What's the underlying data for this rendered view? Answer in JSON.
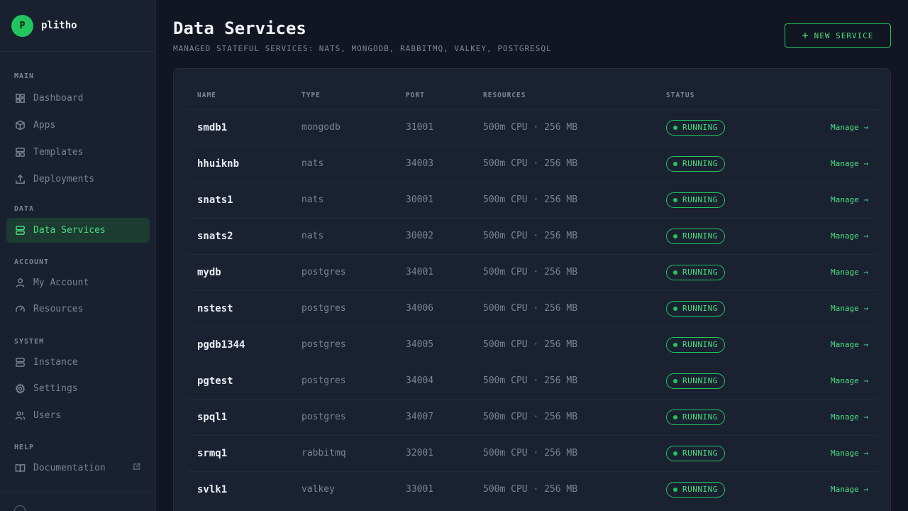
{
  "brand": {
    "logo_letter": "P",
    "name": "plitho"
  },
  "sidebar": {
    "sections": [
      {
        "heading": "MAIN",
        "items": [
          {
            "label": "Dashboard",
            "icon": "grid-icon"
          },
          {
            "label": "Apps",
            "icon": "cube-icon"
          },
          {
            "label": "Templates",
            "icon": "layout-icon"
          },
          {
            "label": "Deployments",
            "icon": "upload-icon"
          }
        ]
      },
      {
        "heading": "DATA",
        "items": [
          {
            "label": "Data Services",
            "icon": "server-icon",
            "active": true
          }
        ]
      },
      {
        "heading": "ACCOUNT",
        "items": [
          {
            "label": "My Account",
            "icon": "user-icon"
          },
          {
            "label": "Resources",
            "icon": "gauge-icon"
          }
        ]
      },
      {
        "heading": "SYSTEM",
        "items": [
          {
            "label": "Instance",
            "icon": "server-icon"
          },
          {
            "label": "Settings",
            "icon": "gear-icon"
          },
          {
            "label": "Users",
            "icon": "users-icon"
          }
        ]
      },
      {
        "heading": "HELP",
        "items": [
          {
            "label": "Documentation",
            "icon": "book-icon",
            "external": true
          }
        ]
      }
    ]
  },
  "header": {
    "title": "Data Services",
    "subtitle": "MANAGED STATEFUL SERVICES: NATS, MONGODB, RABBITMQ, VALKEY, POSTGRESQL",
    "new_button_label": "NEW SERVICE"
  },
  "table": {
    "columns": [
      "NAME",
      "TYPE",
      "PORT",
      "RESOURCES",
      "STATUS"
    ],
    "action_label": "Manage →",
    "rows": [
      {
        "name": "smdb1",
        "type": "mongodb",
        "port": "31001",
        "resources": "500m CPU · 256 MB",
        "status": "RUNNING"
      },
      {
        "name": "hhuiknb",
        "type": "nats",
        "port": "34003",
        "resources": "500m CPU · 256 MB",
        "status": "RUNNING"
      },
      {
        "name": "snats1",
        "type": "nats",
        "port": "30001",
        "resources": "500m CPU · 256 MB",
        "status": "RUNNING"
      },
      {
        "name": "snats2",
        "type": "nats",
        "port": "30002",
        "resources": "500m CPU · 256 MB",
        "status": "RUNNING"
      },
      {
        "name": "mydb",
        "type": "postgres",
        "port": "34001",
        "resources": "500m CPU · 256 MB",
        "status": "RUNNING"
      },
      {
        "name": "nstest",
        "type": "postgres",
        "port": "34006",
        "resources": "500m CPU · 256 MB",
        "status": "RUNNING"
      },
      {
        "name": "pgdb1344",
        "type": "postgres",
        "port": "34005",
        "resources": "500m CPU · 256 MB",
        "status": "RUNNING"
      },
      {
        "name": "pgtest",
        "type": "postgres",
        "port": "34004",
        "resources": "500m CPU · 256 MB",
        "status": "RUNNING"
      },
      {
        "name": "spql1",
        "type": "postgres",
        "port": "34007",
        "resources": "500m CPU · 256 MB",
        "status": "RUNNING"
      },
      {
        "name": "srmq1",
        "type": "rabbitmq",
        "port": "32001",
        "resources": "500m CPU · 256 MB",
        "status": "RUNNING"
      },
      {
        "name": "svlk1",
        "type": "valkey",
        "port": "33001",
        "resources": "500m CPU · 256 MB",
        "status": "RUNNING"
      }
    ]
  },
  "colors": {
    "accent": "#22c55e",
    "background": "#111622",
    "sidebar": "#192130"
  }
}
